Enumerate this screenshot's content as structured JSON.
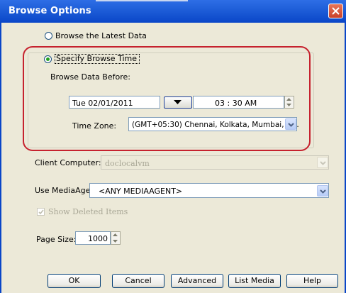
{
  "window": {
    "title": "Browse Options"
  },
  "options": {
    "latest_label": "Browse the Latest Data",
    "specify_label": "Specify Browse Time",
    "selected": "specify"
  },
  "browse_time": {
    "before_label": "Browse Data Before:",
    "date_value": "Tue 02/01/2011",
    "time_value": "03 : 30 AM",
    "timezone_label": "Time Zone:",
    "timezone_value": "(GMT+05:30) Chennai, Kolkata, Mumbai, N..."
  },
  "client": {
    "label": "Client Computer:",
    "value": "doclocalvm"
  },
  "media_agent": {
    "label": "Use MediaAgent",
    "value": "<ANY MEDIAAGENT>"
  },
  "show_deleted": {
    "label": "Show Deleted Items",
    "checked": true
  },
  "page_size": {
    "label": "Page Size:",
    "value": "1000"
  },
  "buttons": {
    "ok": "OK",
    "cancel": "Cancel",
    "advanced": "Advanced",
    "list_media": "List Media",
    "help": "Help"
  },
  "colors": {
    "title_bar": "#0a46c8",
    "highlight": "#c6222e",
    "panel": "#ece9d8"
  },
  "icons": {
    "close": "close-icon",
    "dropdown": "chevron-down-icon",
    "spin_up": "spin-up-icon",
    "spin_down": "spin-down-icon",
    "check": "check-icon"
  }
}
